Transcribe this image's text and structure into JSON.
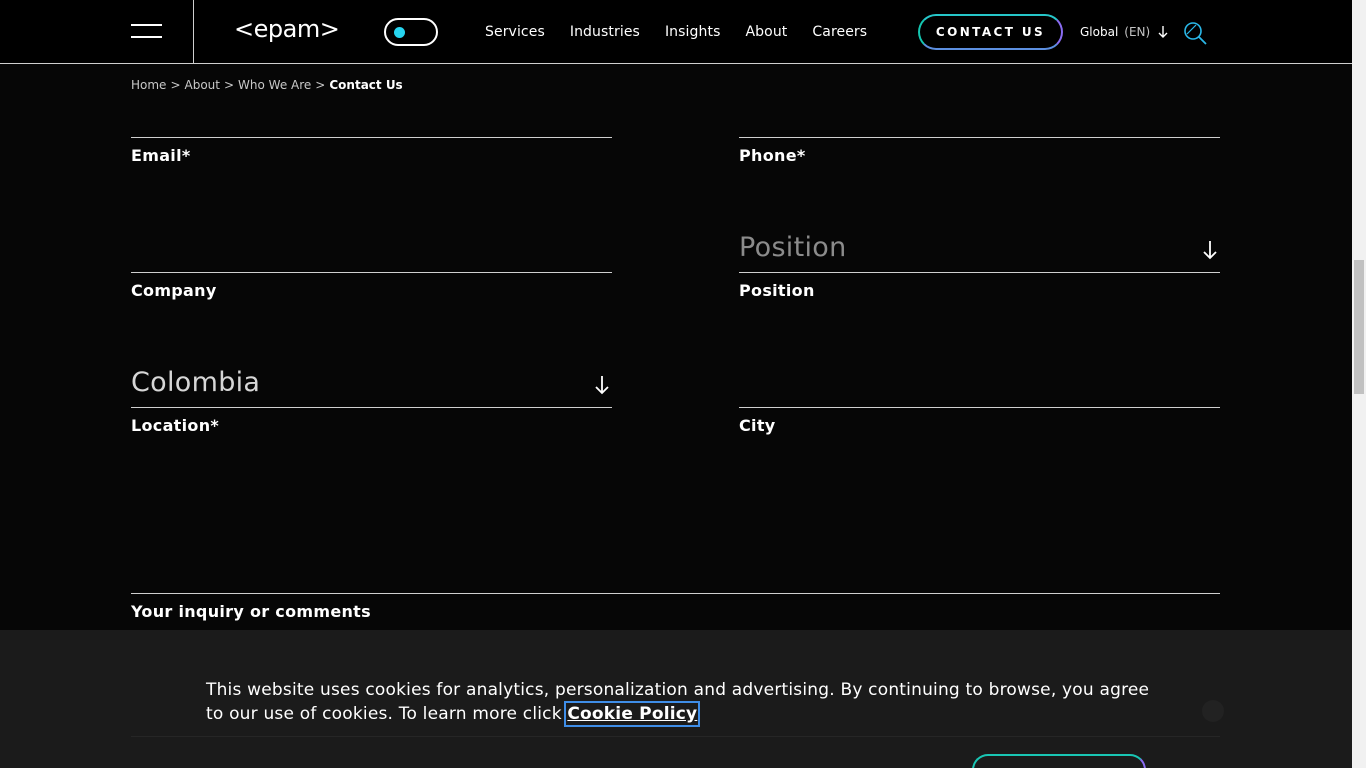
{
  "header": {
    "logo": "<epam>",
    "nav": [
      "Services",
      "Industries",
      "Insights",
      "About",
      "Careers"
    ],
    "contact_button": "CONTACT US",
    "region": "Global",
    "language": "(EN)"
  },
  "breadcrumb": {
    "items": [
      "Home",
      "About",
      "Who We Are"
    ],
    "separator": ">",
    "current": "Contact Us"
  },
  "form": {
    "email": {
      "label": "Email*",
      "value": ""
    },
    "phone": {
      "label": "Phone*",
      "value": ""
    },
    "company": {
      "label": "Company",
      "value": ""
    },
    "position": {
      "label": "Position",
      "placeholder": "Position"
    },
    "location": {
      "label": "Location*",
      "value": "Colombia"
    },
    "city": {
      "label": "City",
      "value": ""
    },
    "comments": {
      "label": "Your inquiry or comments",
      "value": ""
    }
  },
  "cookie_banner": {
    "text": "This website uses cookies for analytics, personalization and advertising. By continuing to browse, you agree to our use of cookies. To learn more click ",
    "link": "Cookie Policy"
  },
  "colors": {
    "background": "#060606",
    "accent_teal": "#14c6b0",
    "accent_violet": "#8a6cf2",
    "toggle_dot": "#27d5f0",
    "banner_bg": "#1b1b1b"
  },
  "icons": [
    "menu-icon",
    "theme-toggle",
    "arrow-down-icon",
    "search-icon",
    "close-icon"
  ]
}
